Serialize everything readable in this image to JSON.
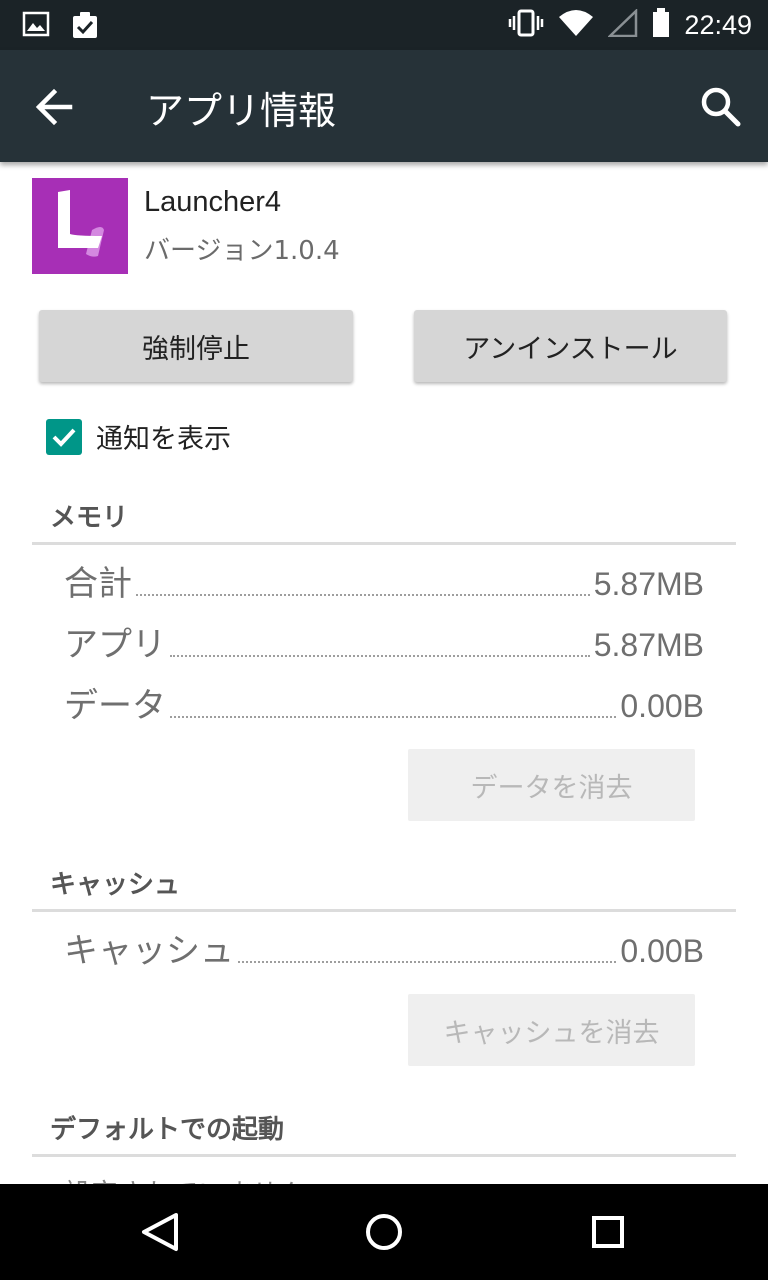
{
  "status_bar": {
    "left_icons": [
      "image-notification-icon",
      "clipboard-check-icon"
    ],
    "right_icons": [
      "vibrate-icon",
      "wifi-icon",
      "signal-icon",
      "battery-icon"
    ],
    "time": "22:49"
  },
  "app_bar": {
    "title": "アプリ情報",
    "background": "#263238"
  },
  "app": {
    "name": "Launcher4",
    "version": "バージョン1.0.4",
    "icon_color": "#a72fb6"
  },
  "buttons": {
    "force_stop": "強制停止",
    "uninstall": "アンインストール"
  },
  "notifications": {
    "label": "通知を表示",
    "checked": true,
    "accent": "#009688"
  },
  "memory": {
    "title": "メモリ",
    "rows": [
      {
        "label": "合計",
        "value": "5.87MB"
      },
      {
        "label": "アプリ",
        "value": "5.87MB"
      },
      {
        "label": "データ",
        "value": "0.00B"
      }
    ],
    "clear_button": "データを消去"
  },
  "cache": {
    "title": "キャッシュ",
    "row": {
      "label": "キャッシュ",
      "value": "0.00B"
    },
    "clear_button": "キャッシュを消去"
  },
  "defaults": {
    "title": "デフォルトでの起動",
    "partial_text": "設定されていません"
  },
  "nav_bar": {
    "icons": [
      "back-triangle-icon",
      "home-circle-icon",
      "recents-square-icon"
    ]
  }
}
